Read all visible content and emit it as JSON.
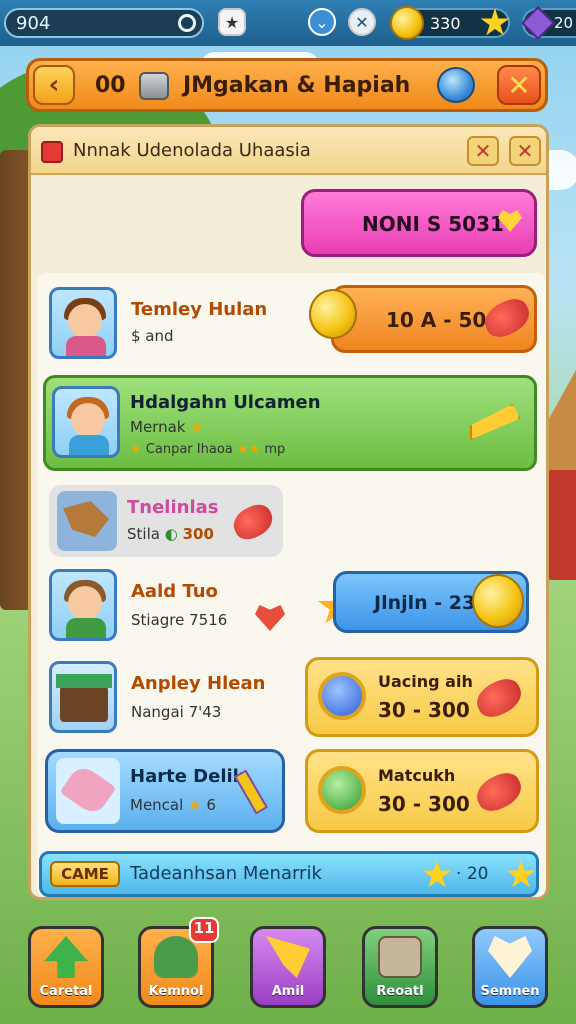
{
  "topbar": {
    "score": "904",
    "coins": "330",
    "gems": "20"
  },
  "titlebar": {
    "prefix": "00",
    "title": "JMgakan & Hapiah"
  },
  "subheader": {
    "title": "Nnnak Udenolada Uhaasia"
  },
  "bonus": {
    "label": "NONI S 5031"
  },
  "rows": [
    {
      "name": "Temley Hulan",
      "sub": "$ and",
      "reward": "10 A - 500"
    },
    {
      "name": "Hdalgahn Ulcamen",
      "sub": "Mernak",
      "detail": "Canpar Ihaoa",
      "detail_tail": "mp"
    },
    {
      "name": "Tnelinlas",
      "sub": "Stila",
      "value": "300"
    },
    {
      "name": "Aald Tuo",
      "sub": "Stiagre 7516",
      "reward": "Jlnjln - 230"
    },
    {
      "name": "Anpley Hlean",
      "sub": "Nangai 7'43",
      "reward_title": "Uacing aih",
      "reward": "30 - 300"
    },
    {
      "name": "Harte Delik",
      "sub": "Mencal",
      "sub_tail": "6",
      "reward_title": "Matcukh",
      "reward": "30 - 300"
    }
  ],
  "footer": {
    "tag": "CAME",
    "text": "Tadeanhsan Menarrik",
    "count": "20"
  },
  "nav": [
    {
      "label": "Caretal",
      "color": "#f08a1c"
    },
    {
      "label": "Kemnol",
      "badge": "11",
      "color": "#f08a1c"
    },
    {
      "label": "Amil",
      "color": "#b24fd6"
    },
    {
      "label": "Reoatl",
      "color": "#3fa24a"
    },
    {
      "label": "Semnen",
      "color": "#3d93e6"
    }
  ]
}
